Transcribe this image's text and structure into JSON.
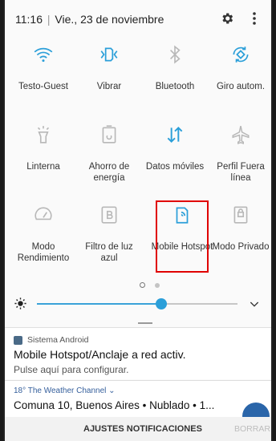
{
  "status_bar": {
    "time": "11:16",
    "separator": "|",
    "date": "Vie., 23 de noviembre",
    "icons": [
      "gear-icon",
      "more-vertical-icon"
    ]
  },
  "tiles": [
    {
      "label": "Testo-Guest",
      "icon": "wifi-icon",
      "active": true
    },
    {
      "label": "Vibrar",
      "icon": "vibrate-icon",
      "active": true
    },
    {
      "label": "Bluetooth",
      "icon": "bluetooth-icon",
      "active": false
    },
    {
      "label": "Giro autom.",
      "icon": "auto-rotate-icon",
      "active": true
    },
    {
      "label": "Linterna",
      "icon": "flashlight-icon",
      "active": false
    },
    {
      "label": "Ahorro de energía",
      "icon": "power-saving-icon",
      "active": false
    },
    {
      "label": "Datos móviles",
      "icon": "mobile-data-icon",
      "active": true
    },
    {
      "label": "Perfil Fuera línea",
      "icon": "airplane-icon",
      "active": false
    },
    {
      "label": "Modo Rendimiento",
      "icon": "speedometer-icon",
      "active": false
    },
    {
      "label": "Filtro de luz azul",
      "icon": "blue-light-filter-icon",
      "active": false
    },
    {
      "label": "Mobile Hotspot",
      "icon": "hotspot-icon",
      "active": true
    },
    {
      "label": "Modo Privado",
      "icon": "private-mode-icon",
      "active": false
    }
  ],
  "page_dots": {
    "count": 2,
    "active": 0
  },
  "brightness": {
    "level": 0.62
  },
  "notification": {
    "app": "Sistema Android",
    "title": "Mobile Hotspot/Anclaje a red activ.",
    "body": "Pulse aquí para configurar."
  },
  "weather": {
    "source": "18° The Weather Channel ⌄",
    "title": "Comuna 10, Buenos Aires • Nublado • 1..."
  },
  "actions": {
    "settings": "AJUSTES NOTIFICACIONES",
    "clear": "BORRAR"
  },
  "colors": {
    "accent": "#2b9fd9",
    "inactive_icon": "#b8b8b8",
    "highlight": "#e00000"
  }
}
